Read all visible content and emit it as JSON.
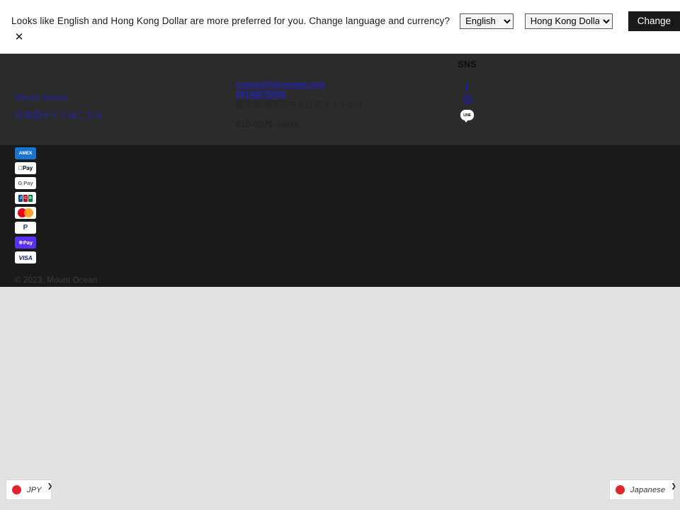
{
  "notice": {
    "message": "Looks like English and Hong Kong Dollar are more preferred for you. Change language and currency?",
    "language_selected": "English",
    "language_options": [
      "English"
    ],
    "currency_selected": "Hong Kong Dollar",
    "currency_options": [
      "Hong Kong Dollar"
    ],
    "change_label": "Change",
    "close_icon": "✕"
  },
  "footer": {
    "brand_links": [
      {
        "label": "Mount Ocean"
      },
      {
        "label": "日本語サイトはこちら"
      }
    ],
    "contact": {
      "email": "contact@itoyamat.com",
      "phone": "09140075989",
      "address_jp": "福岡県福岡市中央区港 2-1-7-201",
      "address_line": "2-1-7-201",
      "postal": "810-0076 Japan"
    },
    "sns": {
      "title": "SNS",
      "facebook_icon": "f",
      "line_label": "LINE"
    },
    "payments": [
      {
        "name": "amex",
        "label": "AMEX"
      },
      {
        "name": "apple-pay",
        "label": " Pay"
      },
      {
        "name": "google-pay",
        "label": "G Pay"
      },
      {
        "name": "jcb",
        "label": "JCB"
      },
      {
        "name": "mastercard",
        "label": ""
      },
      {
        "name": "paypal",
        "label": "P"
      },
      {
        "name": "shop-pay",
        "label": "Pay"
      },
      {
        "name": "visa",
        "label": "VISA"
      }
    ],
    "copyright": "© 2023, Mount Ocean"
  },
  "bottom_selectors": {
    "currency": {
      "label": "JPY",
      "chevron": "❯"
    },
    "language": {
      "label": "Japanese",
      "chevron": "❯"
    }
  },
  "colors": {
    "footer_upper": "#2b2b2b",
    "footer_lower": "#1a1a1a",
    "link_blue": "#2222aa",
    "accent_dark": "#191919",
    "page_bg": "#e2e2e2"
  }
}
